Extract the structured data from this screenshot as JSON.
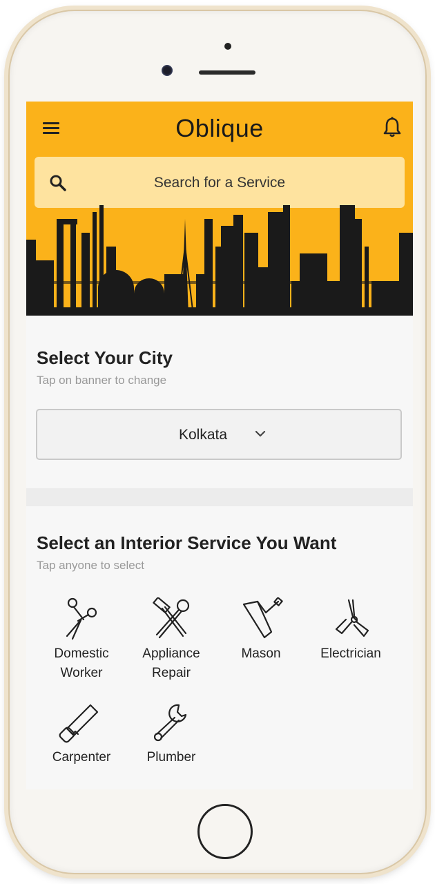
{
  "app": {
    "title": "Oblique"
  },
  "search": {
    "placeholder": "Search for a Service"
  },
  "city": {
    "title": "Select Your City",
    "subtitle": "Tap on banner to change",
    "selected": "Kolkata"
  },
  "services": {
    "title": "Select an Interior Service You Want",
    "subtitle": "Tap anyone to select",
    "items": [
      {
        "label_line1": "Domestic",
        "label_line2": "Worker",
        "icon": "scissors-icon"
      },
      {
        "label_line1": "Appliance",
        "label_line2": "Repair",
        "icon": "hammer-wrench-icon"
      },
      {
        "label_line1": "Mason",
        "label_line2": "",
        "icon": "trowel-icon"
      },
      {
        "label_line1": "Electrician",
        "label_line2": "",
        "icon": "pliers-icon"
      },
      {
        "label_line1": "Carpenter",
        "label_line2": "",
        "icon": "saw-icon"
      },
      {
        "label_line1": "Plumber",
        "label_line2": "",
        "icon": "wrench-icon"
      }
    ]
  },
  "colors": {
    "header": "#fbb21a",
    "skyline": "#1a1a1a"
  }
}
